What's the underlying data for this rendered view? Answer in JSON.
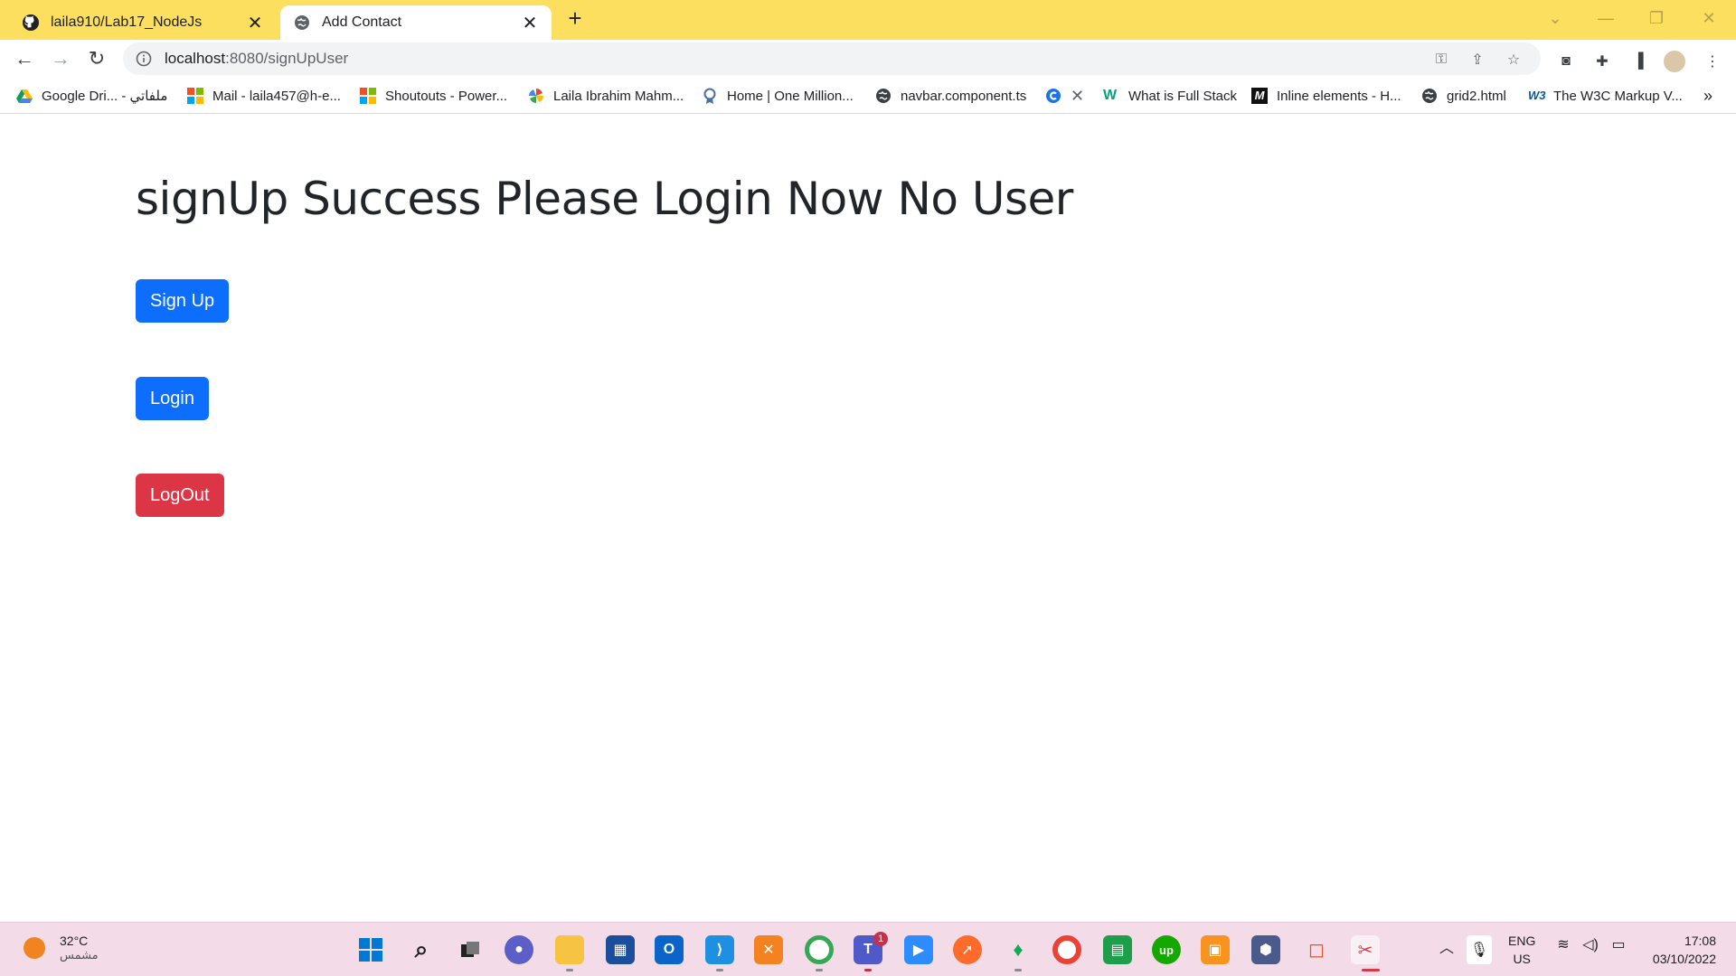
{
  "browser": {
    "tabs": [
      {
        "title": "laila910/Lab17_NodeJs",
        "icon": "github-icon",
        "active": false
      },
      {
        "title": "Add Contact",
        "icon": "globe-icon",
        "active": true
      }
    ],
    "url_host": "localhost",
    "url_rest": ":8080/signUpUser",
    "bookmarks": [
      {
        "label": "Google Dri... - ملفاتي",
        "icon": "google-drive-icon"
      },
      {
        "label": "Mail - laila457@h-e...",
        "icon": "microsoft-icon"
      },
      {
        "label": "Shoutouts - Power...",
        "icon": "microsoft-icon"
      },
      {
        "label": "Laila Ibrahim Mahm...",
        "icon": "pinwheel-icon"
      },
      {
        "label": "Home | One Million...",
        "icon": "badge-icon"
      },
      {
        "label": "navbar.component.ts",
        "icon": "globe-icon"
      },
      {
        "label": "",
        "icon": "c-icon"
      },
      {
        "label": "What is Full Stack",
        "icon": "w-icon"
      },
      {
        "label": "Inline elements - H...",
        "icon": "m-icon"
      },
      {
        "label": "grid2.html",
        "icon": "globe-icon"
      },
      {
        "label": "The W3C Markup V...",
        "icon": "w3c-icon"
      }
    ]
  },
  "page": {
    "title": "signUp Success Please Login Now No User",
    "signup_label": "Sign Up",
    "login_label": "Login",
    "logout_label": "LogOut"
  },
  "colors": {
    "primary": "#0d6efd",
    "danger": "#dc3545",
    "tabstrip": "#fcdf5e"
  },
  "taskbar": {
    "temperature": "32°C",
    "weather_desc": "مشمس",
    "lang_line1": "ENG",
    "lang_line2": "US",
    "time": "17:08",
    "date": "03/10/2022",
    "teams_badge": "1"
  }
}
